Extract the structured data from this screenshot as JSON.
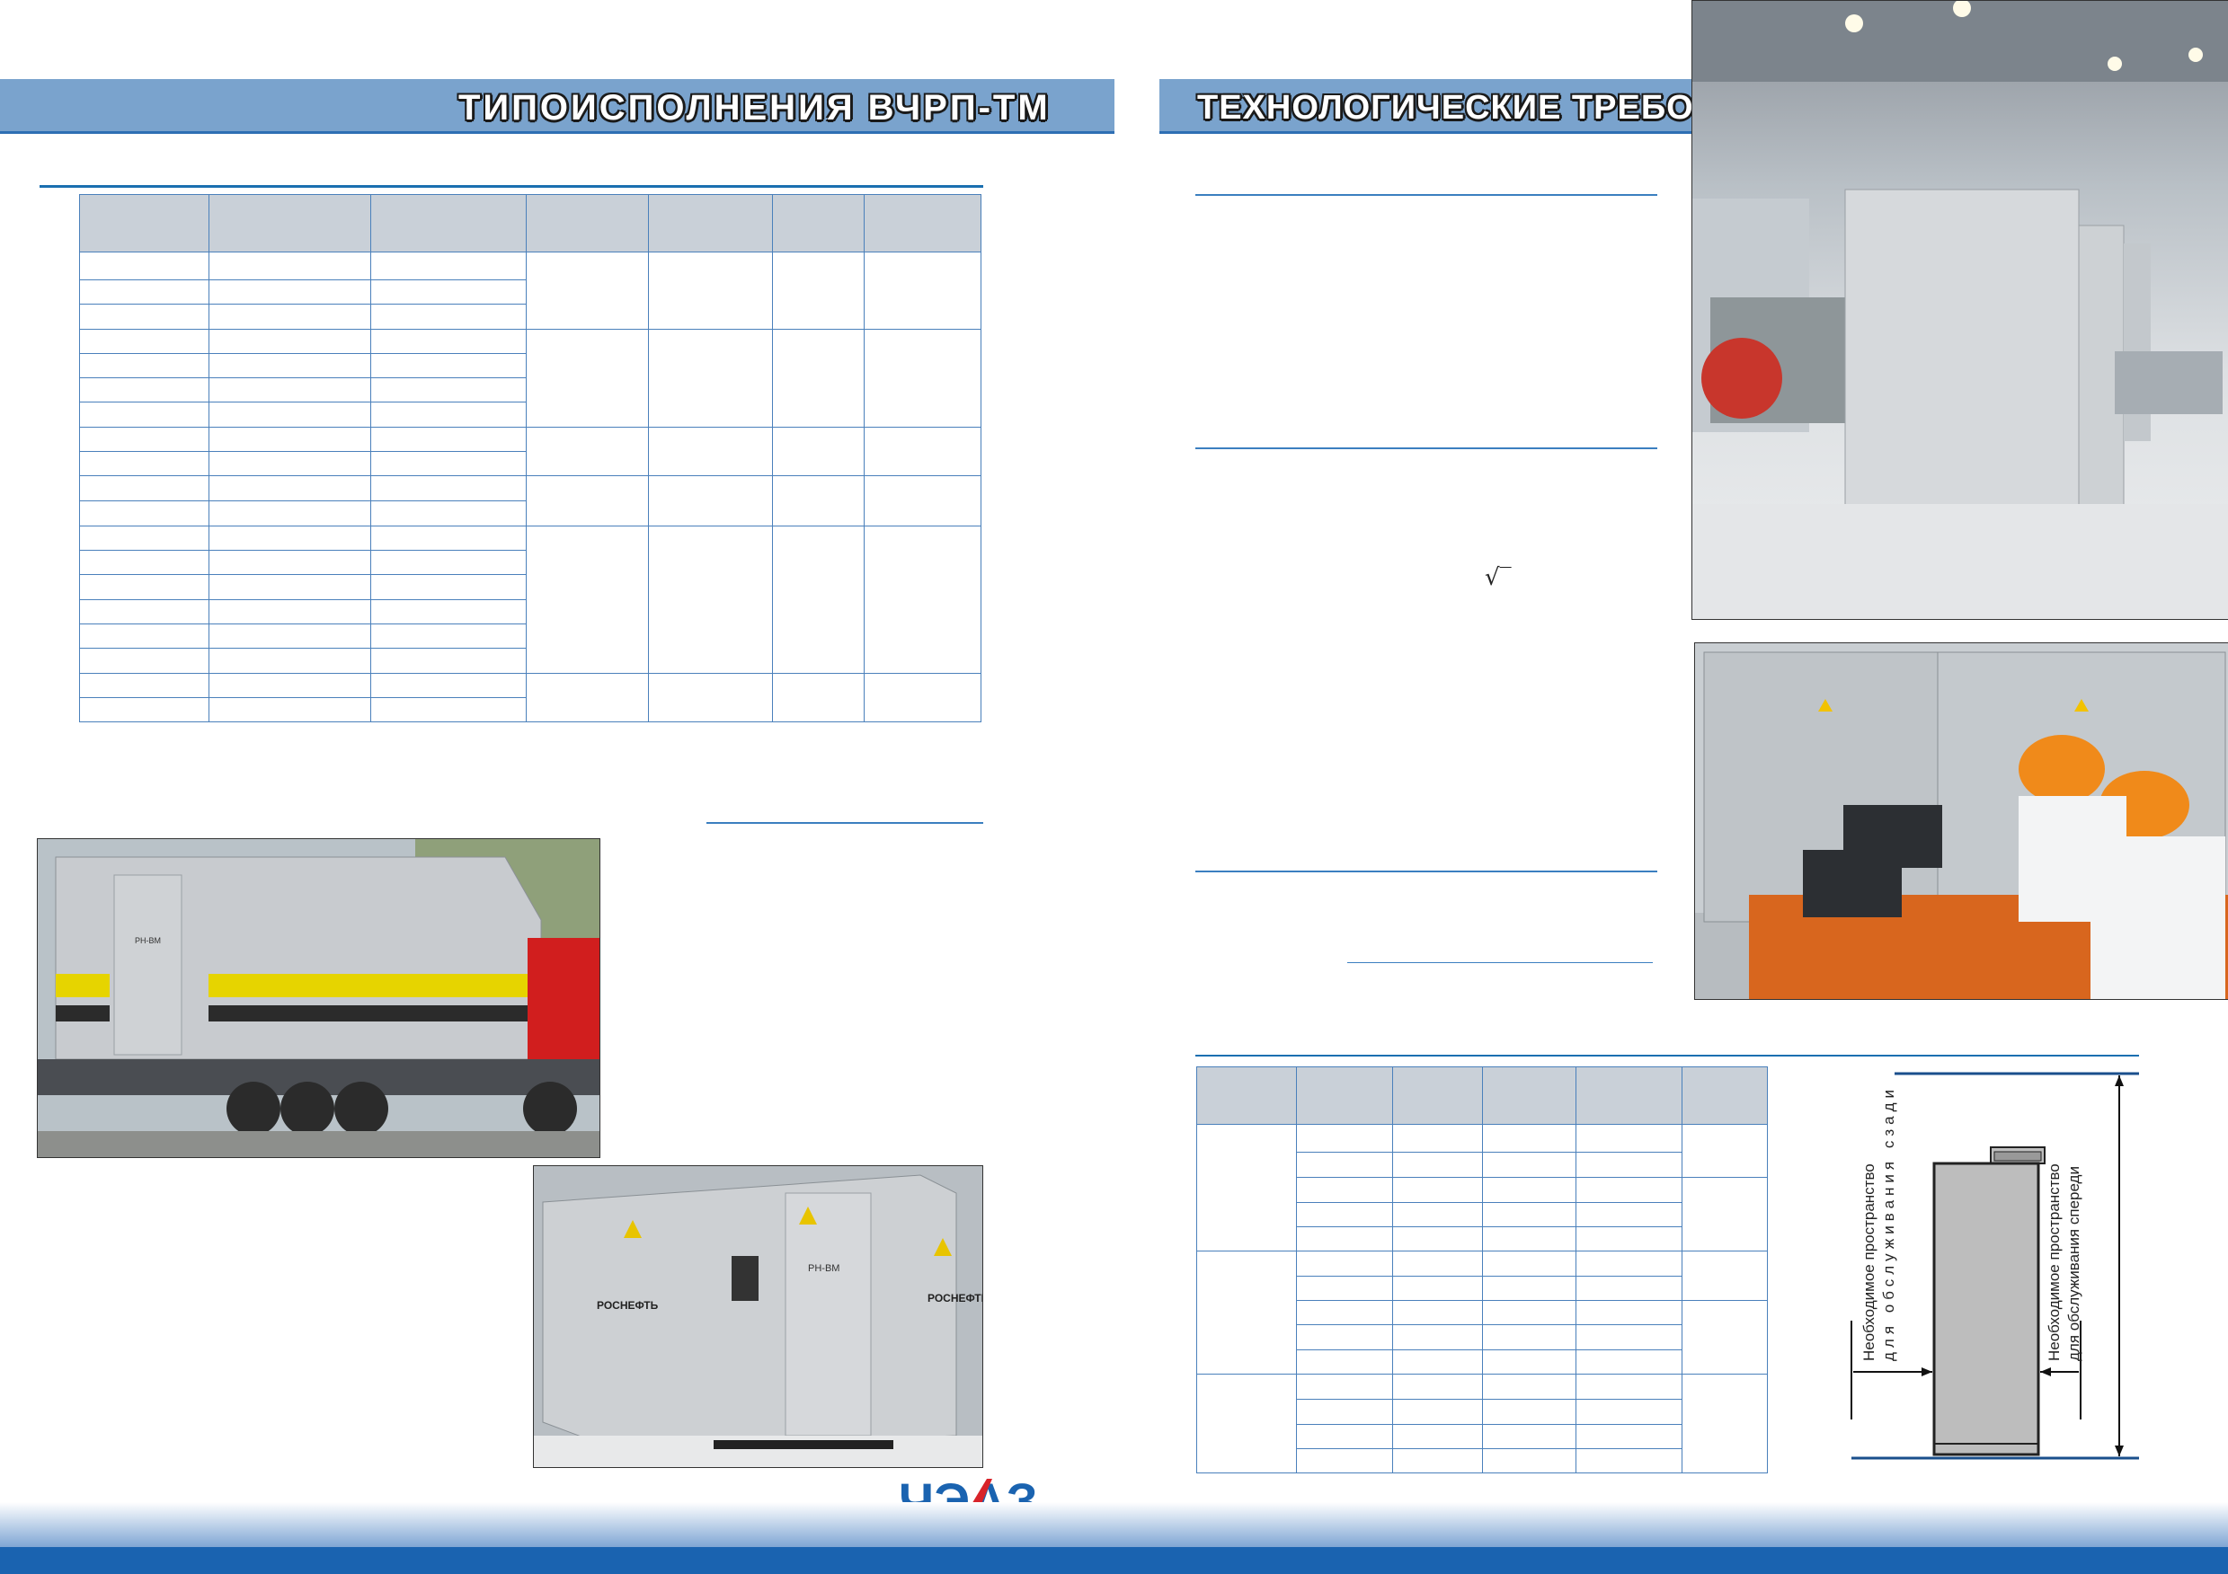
{
  "left_page": {
    "section_title": "ТИПОИСПОЛНЕНИЯ ВЧРП-ТМ"
  },
  "right_page": {
    "section_title": "ТЕХНОЛОГИЧЕСКИЕ ТРЕБОВАНИЯ К ЭКСПЛУАТАЦИИ ВЧРП-ТМ",
    "sqrt_symbol": "√‾"
  },
  "photos": {
    "truck_door_logo": "РН-ВМ",
    "container_door_logo": "РН-ВМ",
    "container_brand_left": "РОСНЕФТЬ",
    "container_brand_right": "РОСНЕФТЬ"
  },
  "diagram": {
    "label_rear_line1": "Необходимое пространство",
    "label_rear_line2": "для обслуживания сзади",
    "label_front_line1": "Необходимое пространство",
    "label_front_line2": "для обслуживания спереди"
  },
  "logo": {
    "text": "ЧЭАЗ"
  },
  "colors": {
    "band": "#7aa3cd",
    "rule": "#1a6fb0",
    "footer": "#1a63b0",
    "logo_blue": "#1a63b0",
    "logo_red": "#d8232a"
  }
}
